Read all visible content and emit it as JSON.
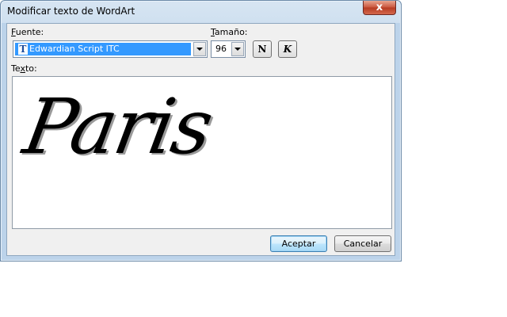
{
  "window": {
    "title": "Modificar texto de WordArt",
    "close_glyph": "x"
  },
  "font": {
    "label_prefix": "F",
    "label_rest": "uente:",
    "value": "Edwardian Script ITC",
    "icon_glyph": "T"
  },
  "size": {
    "label_prefix": "T",
    "label_rest": "amaño:",
    "value": "96"
  },
  "style": {
    "bold_glyph": "N",
    "italic_glyph": "K"
  },
  "text": {
    "label_prefix": "Te",
    "label_mid": "x",
    "label_rest": "to:",
    "value": "Paris"
  },
  "buttons": {
    "ok": "Aceptar",
    "cancel": "Cancelar"
  },
  "colors": {
    "selection": "#3399ff",
    "close_button": "#c9553c",
    "frame": "#bcd3ea"
  }
}
